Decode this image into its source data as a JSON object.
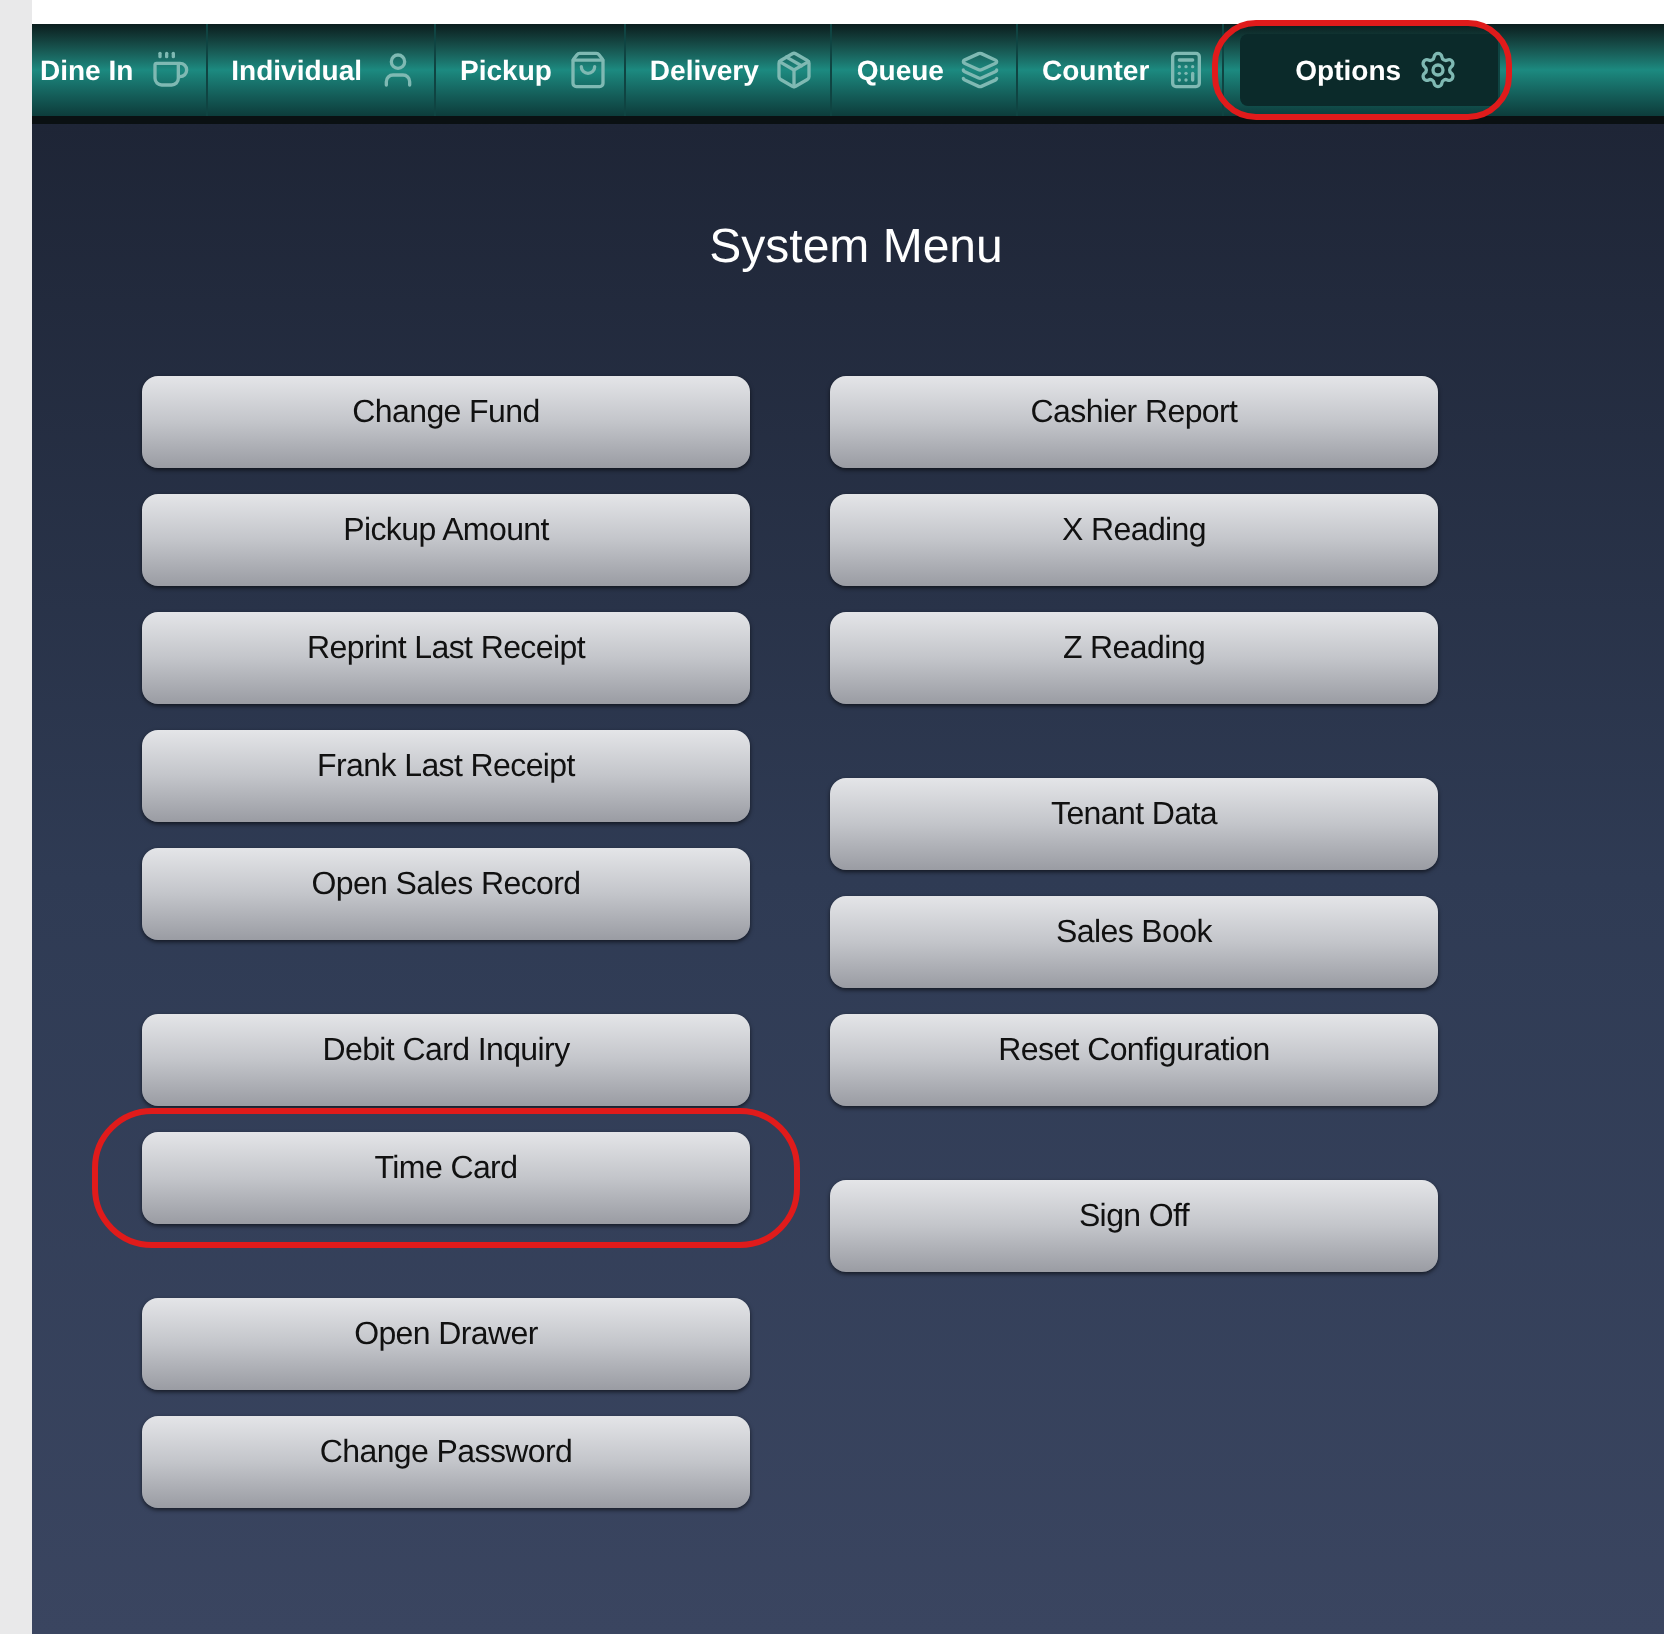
{
  "tabs": [
    {
      "label": "Dine In",
      "selected": false,
      "highlighted": false
    },
    {
      "label": "Individual",
      "selected": false,
      "highlighted": false
    },
    {
      "label": "Pickup",
      "selected": false,
      "highlighted": false
    },
    {
      "label": "Delivery",
      "selected": false,
      "highlighted": false
    },
    {
      "label": "Queue",
      "selected": false,
      "highlighted": false
    },
    {
      "label": "Counter",
      "selected": false,
      "highlighted": false
    },
    {
      "label": "Options",
      "selected": true,
      "highlighted": true
    }
  ],
  "title": "System Menu",
  "columns": [
    [
      [
        {
          "label": "Change Fund",
          "highlighted": false
        },
        {
          "label": "Pickup Amount",
          "highlighted": false
        },
        {
          "label": "Reprint Last Receipt",
          "highlighted": false
        },
        {
          "label": "Frank Last Receipt",
          "highlighted": false
        },
        {
          "label": "Open Sales Record",
          "highlighted": false
        }
      ],
      [
        {
          "label": "Debit Card Inquiry",
          "highlighted": false
        },
        {
          "label": "Time Card",
          "highlighted": true
        }
      ],
      [
        {
          "label": "Open Drawer",
          "highlighted": false
        },
        {
          "label": "Change Password",
          "highlighted": false
        }
      ]
    ],
    [
      [
        {
          "label": "Cashier Report",
          "highlighted": false
        },
        {
          "label": "X Reading",
          "highlighted": false
        },
        {
          "label": "Z Reading",
          "highlighted": false
        }
      ],
      [
        {
          "label": "Tenant Data",
          "highlighted": false
        },
        {
          "label": "Sales Book",
          "highlighted": false
        },
        {
          "label": "Reset Configuration",
          "highlighted": false
        }
      ],
      [
        {
          "label": "Sign Off",
          "highlighted": false
        }
      ]
    ]
  ]
}
